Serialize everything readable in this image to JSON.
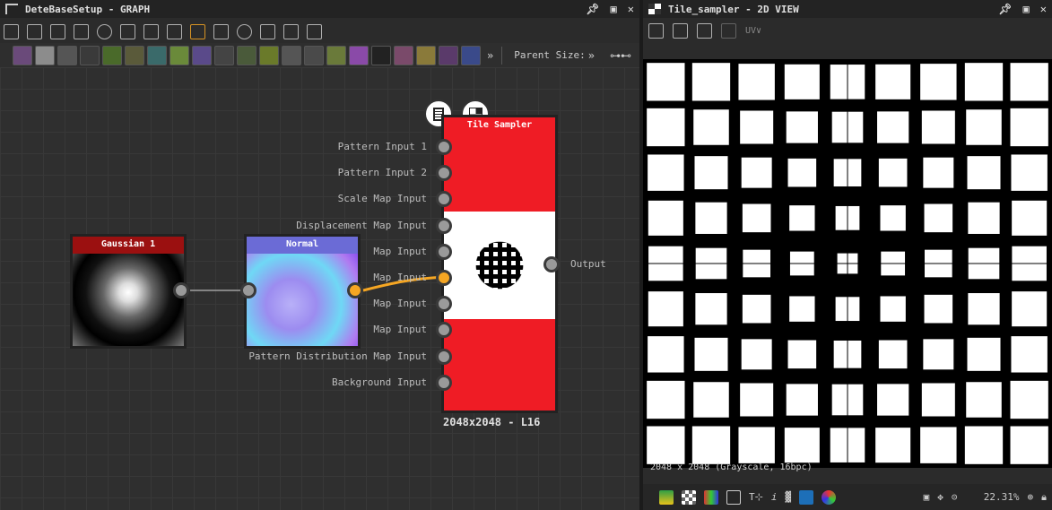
{
  "graph": {
    "title": "DeteBaseSetup - GRAPH",
    "parent_size_label": "Parent Size:",
    "nodes": {
      "gaussian": {
        "title": "Gaussian 1",
        "header_color": "#9b1010"
      },
      "normal": {
        "title": "Normal",
        "header_color": "#6b6bd6"
      },
      "tile_sampler": {
        "title": "Tile Sampler",
        "body_color": "#ef1c25",
        "resolution": "2048x2048 - L16",
        "inputs": [
          "Pattern Input 1",
          "Pattern Input 2",
          "Scale Map Input",
          "Displacement Map Input",
          "Map Input",
          "Map Input",
          "Map Input",
          "Map Input",
          "Pattern Distribution Map Input",
          "Background Input"
        ],
        "output": "Output"
      }
    },
    "connection_color": "#f5a623"
  },
  "view": {
    "title": "Tile_sampler - 2D VIEW",
    "uv_label": "UV∨",
    "image_info": "2048 x 2048 (Grayscale, 16bpc)",
    "zoom": "22.31%"
  }
}
